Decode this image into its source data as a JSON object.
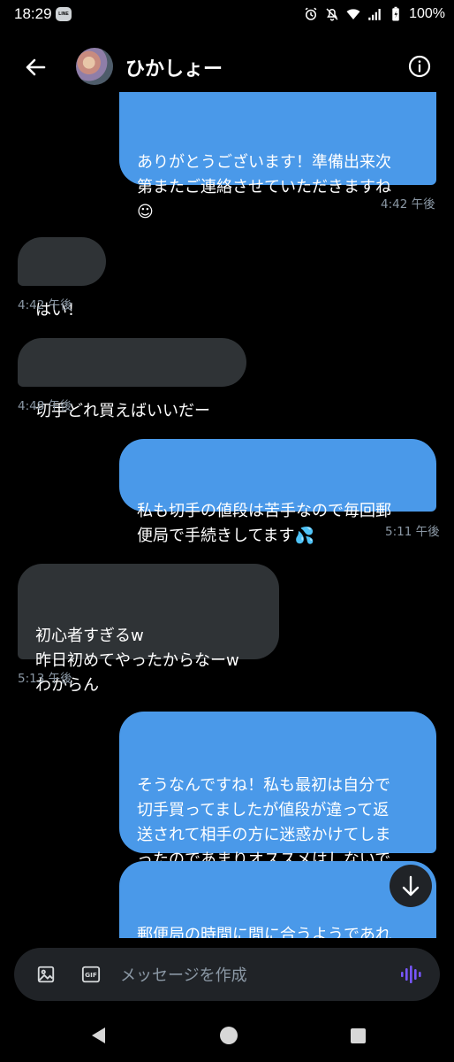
{
  "status_bar": {
    "time": "18:29",
    "line_badge": "LINE",
    "battery_percent": "100%"
  },
  "header": {
    "contact_name": "ひかしょー"
  },
  "messages": [
    {
      "direction": "out",
      "text": "ありがとうございます！準備出来次\n第またご連絡させていただきますね\n☺",
      "time": "4:42 午後"
    },
    {
      "direction": "in",
      "text": "はい！",
      "time": "4:42 午後"
    },
    {
      "direction": "in",
      "text": "切手どれ買えばいいだー",
      "time": "4:48 午後"
    },
    {
      "direction": "out",
      "text": "私も切手の値段は苦手なので毎回郵\n便局で手続きしてます💦",
      "time": "5:11 午後"
    },
    {
      "direction": "in",
      "text": "初心者すぎるw\n昨日初めてやったからなーw\nわからん",
      "time": "5:13 午後"
    },
    {
      "direction": "out",
      "text": "そうなんですね！私も最初は自分で\n切手買ってましたが値段が違って返\n送されて相手の方に迷惑かけてしま\nったのであまりオススメはしないで\nす💦",
      "time": ""
    },
    {
      "direction": "out",
      "text": "郵便局の時間に間に合うようであれ\nば窓口の人に出すだけなので楽です\nよ👍",
      "time": ""
    }
  ],
  "composer": {
    "placeholder": "メッセージを作成",
    "gif_label": "GIF"
  },
  "colors": {
    "background": "#000000",
    "outgoing_bubble": "#4a99e9",
    "incoming_bubble": "#2f3336",
    "timestamp": "#8b98a5",
    "voice_accent": "#7856ff"
  }
}
